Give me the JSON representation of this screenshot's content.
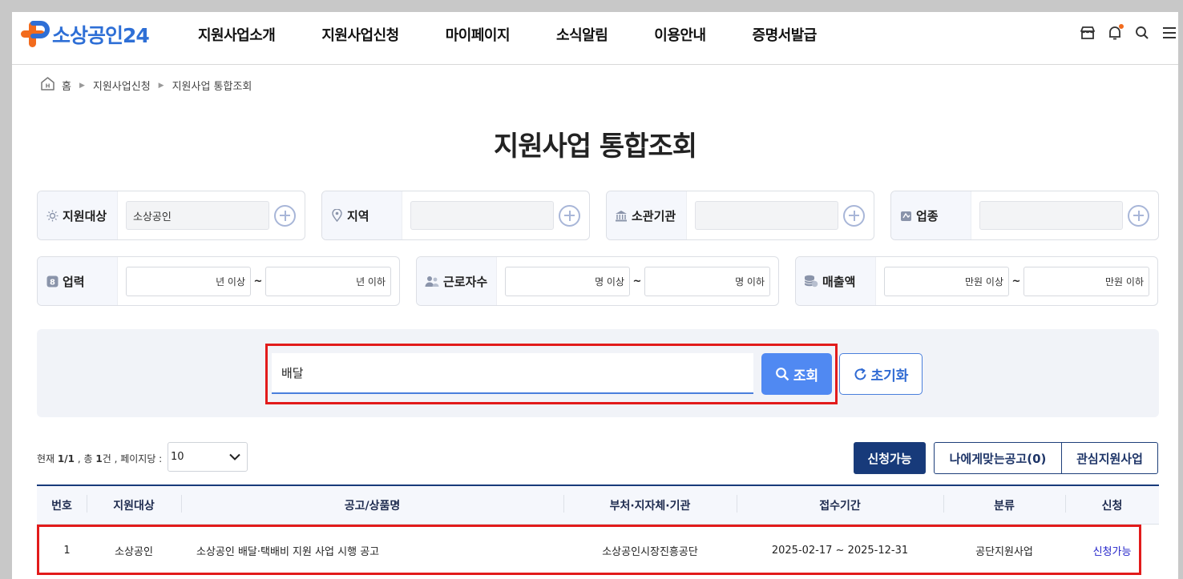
{
  "header": {
    "logo_text": "소상공인24",
    "menu": [
      "지원사업소개",
      "지원사업신청",
      "마이페이지",
      "소식알림",
      "이용안내",
      "증명서발급"
    ]
  },
  "breadcrumb": [
    "홈",
    "지원사업신청",
    "지원사업 통합조회"
  ],
  "page_title": "지원사업 통합조회",
  "filters": {
    "target": {
      "label": "지원대상",
      "value": "소상공인"
    },
    "region": {
      "label": "지역",
      "value": ""
    },
    "agency": {
      "label": "소관기관",
      "value": ""
    },
    "industry": {
      "label": "업종",
      "value": ""
    },
    "years": {
      "label": "업력",
      "min_placeholder": "년 이상",
      "max_placeholder": "년 이하"
    },
    "workers": {
      "label": "근로자수",
      "min_placeholder": "명 이상",
      "max_placeholder": "명 이하"
    },
    "sales": {
      "label": "매출액",
      "min_placeholder": "만원 이상",
      "max_placeholder": "만원 이하"
    }
  },
  "search": {
    "value": "배달",
    "search_button": "조회",
    "reset_button": "초기화"
  },
  "list_status": {
    "current_label": "현재",
    "current": "1/1",
    "total_label": ", 총",
    "total": "1",
    "unit": "건",
    "per_page_label": ", 페이지당 :",
    "per_page": "10"
  },
  "tabs": {
    "available": "신청가능",
    "matched": "나에게맞는공고(0)",
    "interest": "관심지원사업"
  },
  "table": {
    "headers": [
      "번호",
      "지원대상",
      "공고/상품명",
      "부처·지자체·기관",
      "접수기간",
      "분류",
      "신청"
    ],
    "rows": [
      [
        "1",
        "소상공인",
        "소상공인 배달·택배비 지원 사업 시행 공고",
        "소상공인시장진흥공단",
        "2025-02-17 ~ 2025-12-31",
        "공단지원사업",
        "신청가능"
      ]
    ]
  },
  "colors": {
    "brand_blue": "#2e6fd6",
    "brand_orange": "#f26b1d",
    "navy": "#173a7a",
    "search_button": "#5089f2",
    "highlight_red": "#e21b1b"
  }
}
